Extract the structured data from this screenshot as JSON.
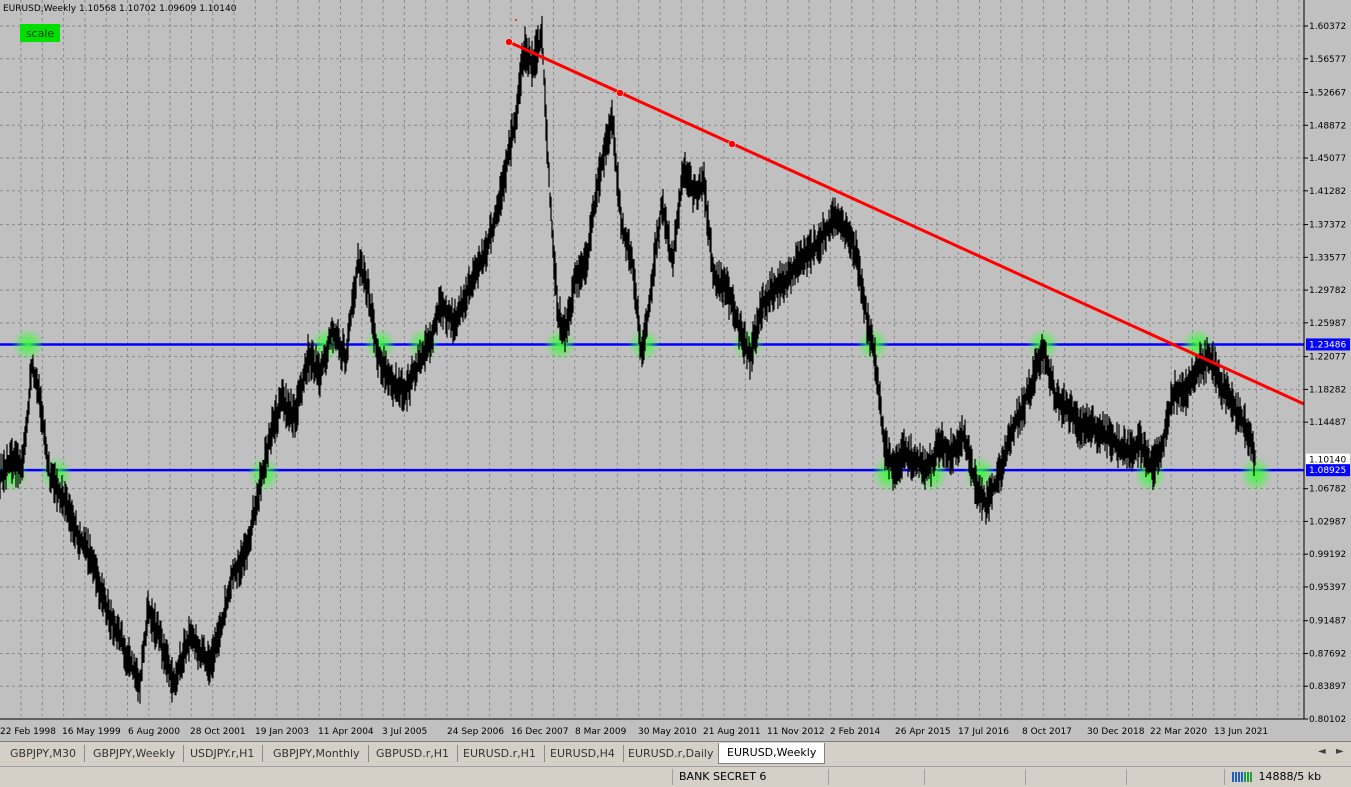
{
  "chart": {
    "symbol_line": "EURUSD,Weekly  1.10568 1.10702 1.09609 1.10140",
    "scale_button": "scale",
    "price_labels": [
      "1.60372",
      "1.56577",
      "1.52667",
      "1.48872",
      "1.45077",
      "1.41282",
      "1.37372",
      "1.33577",
      "1.29782",
      "1.25987",
      "1.22077",
      "1.18282",
      "1.14487",
      "1.06782",
      "1.02987",
      "0.99192",
      "0.95397",
      "0.91487",
      "0.87692",
      "0.83897",
      "0.80102"
    ],
    "date_labels": [
      "22 Feb 1998",
      "16 May 1999",
      "6 Aug 2000",
      "28 Oct 2001",
      "19 Jan 2003",
      "11 Apr 2004",
      "3 Jul 2005",
      "24 Sep 2006",
      "16 Dec 2007",
      "8 Mar 2009",
      "30 May 2010",
      "21 Aug 2011",
      "11 Nov 2012",
      "2 Feb 2014",
      "26 Apr 2015",
      "17 Jul 2016",
      "8 Oct 2017",
      "30 Dec 2018",
      "22 Mar 2020",
      "13 Jun 2021"
    ],
    "current_price_label": "1.10140",
    "support_label": "1.08925",
    "resistance_label": "1.23486",
    "colors": {
      "background": "#c0c0c0",
      "price_line": "#000000",
      "support_resistance": "#0000ff",
      "trendline": "#ff0000",
      "highlight": "#33ff33"
    }
  },
  "tabs": [
    {
      "label": "GBPJPY,M30"
    },
    {
      "label": "GBPJPY,Weekly"
    },
    {
      "label": "USDJPY.r,H1"
    },
    {
      "label": "GBPJPY,Monthly"
    },
    {
      "label": "GBPUSD.r,H1"
    },
    {
      "label": "EURUSD.r,H1"
    },
    {
      "label": "EURUSD,H4"
    },
    {
      "label": "EURUSD.r,Daily"
    },
    {
      "label": "EURUSD,Weekly"
    }
  ],
  "status": {
    "profile": "BANK SECRET 6",
    "traffic": "14888/5 kb"
  }
}
